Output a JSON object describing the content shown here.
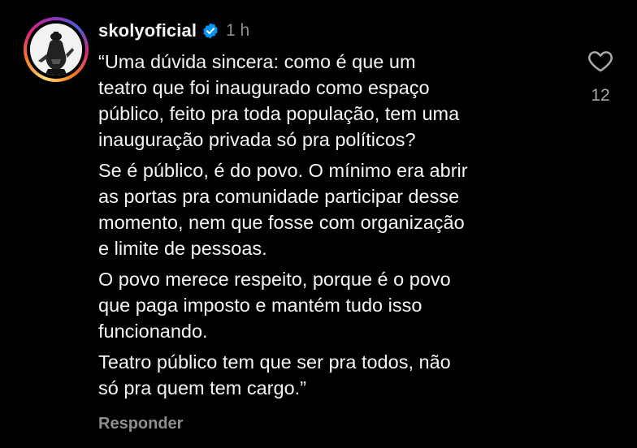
{
  "comment": {
    "username": "skolyoficial",
    "timestamp": "1 h",
    "paragraphs": [
      [
        "“Uma dúvida sincera: como é que um",
        "teatro que foi inaugurado como espaço",
        "público, feito pra toda população, tem uma",
        "inauguração privada só pra políticos?"
      ],
      [
        "Se é público, é do povo. O mínimo era abrir",
        "as portas pra comunidade participar desse",
        "momento, nem que fosse com organização",
        "e limite de pessoas."
      ],
      [
        "O povo merece respeito, porque é o povo",
        "que paga imposto e mantém tudo isso",
        "funcionando."
      ],
      [
        "Teatro público tem que ser pra todos, não",
        "só pra quem tem cargo.”"
      ]
    ],
    "reply_label": "Responder",
    "like_count": "12"
  },
  "icons": {
    "verified": "verified-badge-icon",
    "like": "heart-outline-icon"
  },
  "colors": {
    "background": "#000000",
    "text": "#f5f5f5",
    "secondary": "#8e8e8e",
    "verified": "#0095f6"
  }
}
